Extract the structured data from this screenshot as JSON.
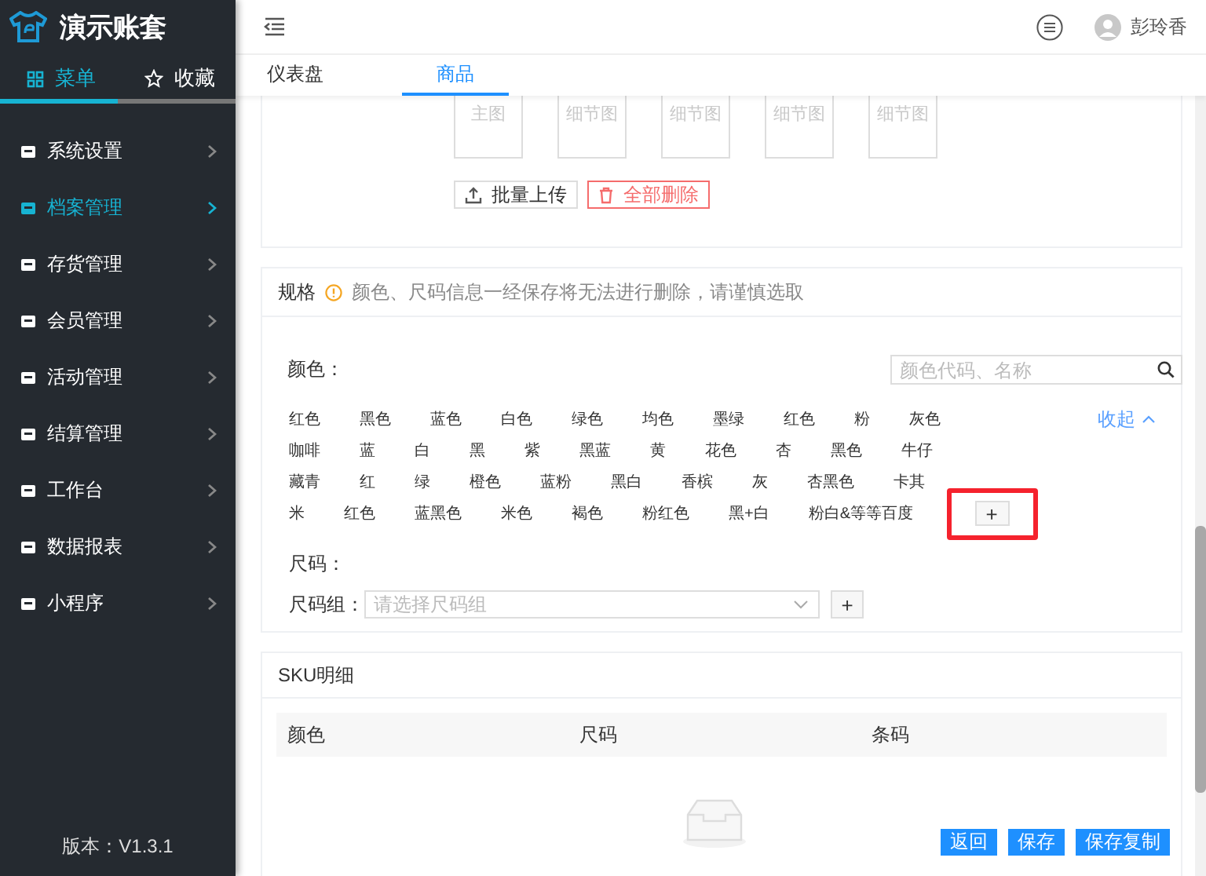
{
  "sidebar": {
    "title": "演示账套",
    "tabs": [
      {
        "label": "菜单",
        "selected": true
      },
      {
        "label": "收藏",
        "selected": false
      }
    ],
    "items": [
      {
        "label": "系统设置",
        "selected": false
      },
      {
        "label": "档案管理",
        "selected": true
      },
      {
        "label": "存货管理",
        "selected": false
      },
      {
        "label": "会员管理",
        "selected": false
      },
      {
        "label": "活动管理",
        "selected": false
      },
      {
        "label": "结算管理",
        "selected": false
      },
      {
        "label": "工作台",
        "selected": false
      },
      {
        "label": "数据报表",
        "selected": false
      },
      {
        "label": "小程序",
        "selected": false
      }
    ],
    "version": "版本：V1.3.1"
  },
  "header": {
    "user": "彭玲香"
  },
  "page_tabs": [
    {
      "label": "仪表盘",
      "selected": false
    },
    {
      "label": "商品",
      "selected": true
    }
  ],
  "images": {
    "slots": [
      "主图",
      "细节图",
      "细节图",
      "细节图",
      "细节图"
    ],
    "buttons": [
      {
        "label": "批量上传",
        "kind": "upload"
      },
      {
        "label": "全部删除",
        "kind": "delete"
      }
    ]
  },
  "spec": {
    "title": "规格",
    "warning": "颜色、尺码信息一经保存将无法进行删除，请谨慎选取",
    "color_label": "颜色：",
    "search": {
      "placeholder": "颜色代码、名称"
    },
    "collapse": "收起",
    "color_rows": [
      [
        "红色",
        "黑色",
        "蓝色",
        "白色",
        "绿色",
        "均色",
        "墨绿",
        "红色",
        "粉",
        "灰色"
      ],
      [
        "咖啡",
        "蓝",
        "白",
        "黑",
        "紫",
        "黑蓝",
        "黄",
        "花色",
        "杏",
        "黑色",
        "牛仔"
      ],
      [
        "藏青",
        "红",
        "绿",
        "橙色",
        "蓝粉",
        "黑白",
        "香槟",
        "灰",
        "杏黑色",
        "卡其"
      ],
      [
        "米",
        "红色",
        "蓝黑色",
        "米色",
        "褐色",
        "粉红色",
        "黑+白",
        "粉白&等等百度"
      ]
    ],
    "add": "+",
    "highlighted": true,
    "size_label": "尺码：",
    "size_group_label": "尺码组：",
    "size_group": {
      "placeholder": "请选择尺码组"
    },
    "size_add": "+"
  },
  "sku": {
    "title": "SKU明细",
    "columns": [
      "颜色",
      "尺码",
      "条码"
    ]
  },
  "actions": [
    "返回",
    "保存",
    "保存复制"
  ]
}
